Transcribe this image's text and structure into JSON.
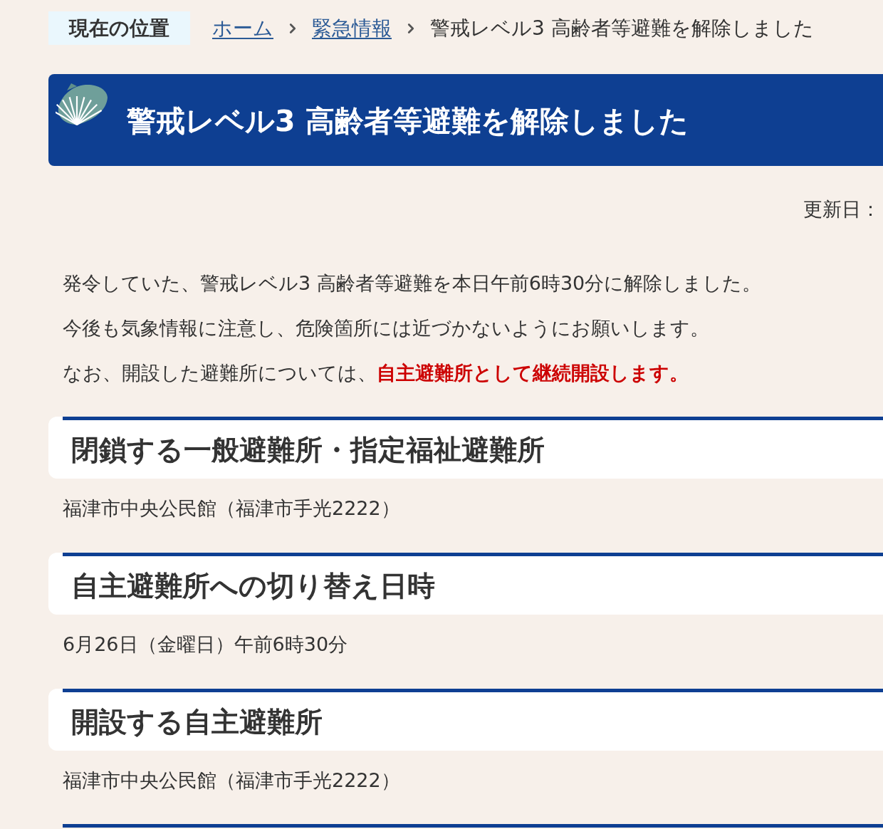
{
  "breadcrumb": {
    "label": "現在の位置",
    "items": [
      {
        "text": "ホーム",
        "kind": "link"
      },
      {
        "text": "緊急情報",
        "kind": "link"
      },
      {
        "text": "警戒レベル3 高齢者等避難を解除しました",
        "kind": "current"
      }
    ]
  },
  "page_title": "警戒レベル3 高齢者等避難を解除しました",
  "updated": "更新日：",
  "paragraphs": [
    "発令していた、警戒レベル3 高齢者等避難を本日午前6時30分に解除しました。",
    "今後も気象情報に注意し、危険箇所には近づかないようにお願いします。",
    "なお、開設した避難所については、**自主避難所として継続開設します。**"
  ],
  "sections": [
    {
      "heading": "閉鎖する一般避難所・指定福祉避難所",
      "body": "福津市中央公民館（福津市手光2222）"
    },
    {
      "heading": "自主避難所への切り替え日時",
      "body": "6月26日（金曜日）午前6時30分"
    },
    {
      "heading": "開設する自主避難所",
      "body": "福津市中央公民館（福津市手光2222）"
    }
  ]
}
